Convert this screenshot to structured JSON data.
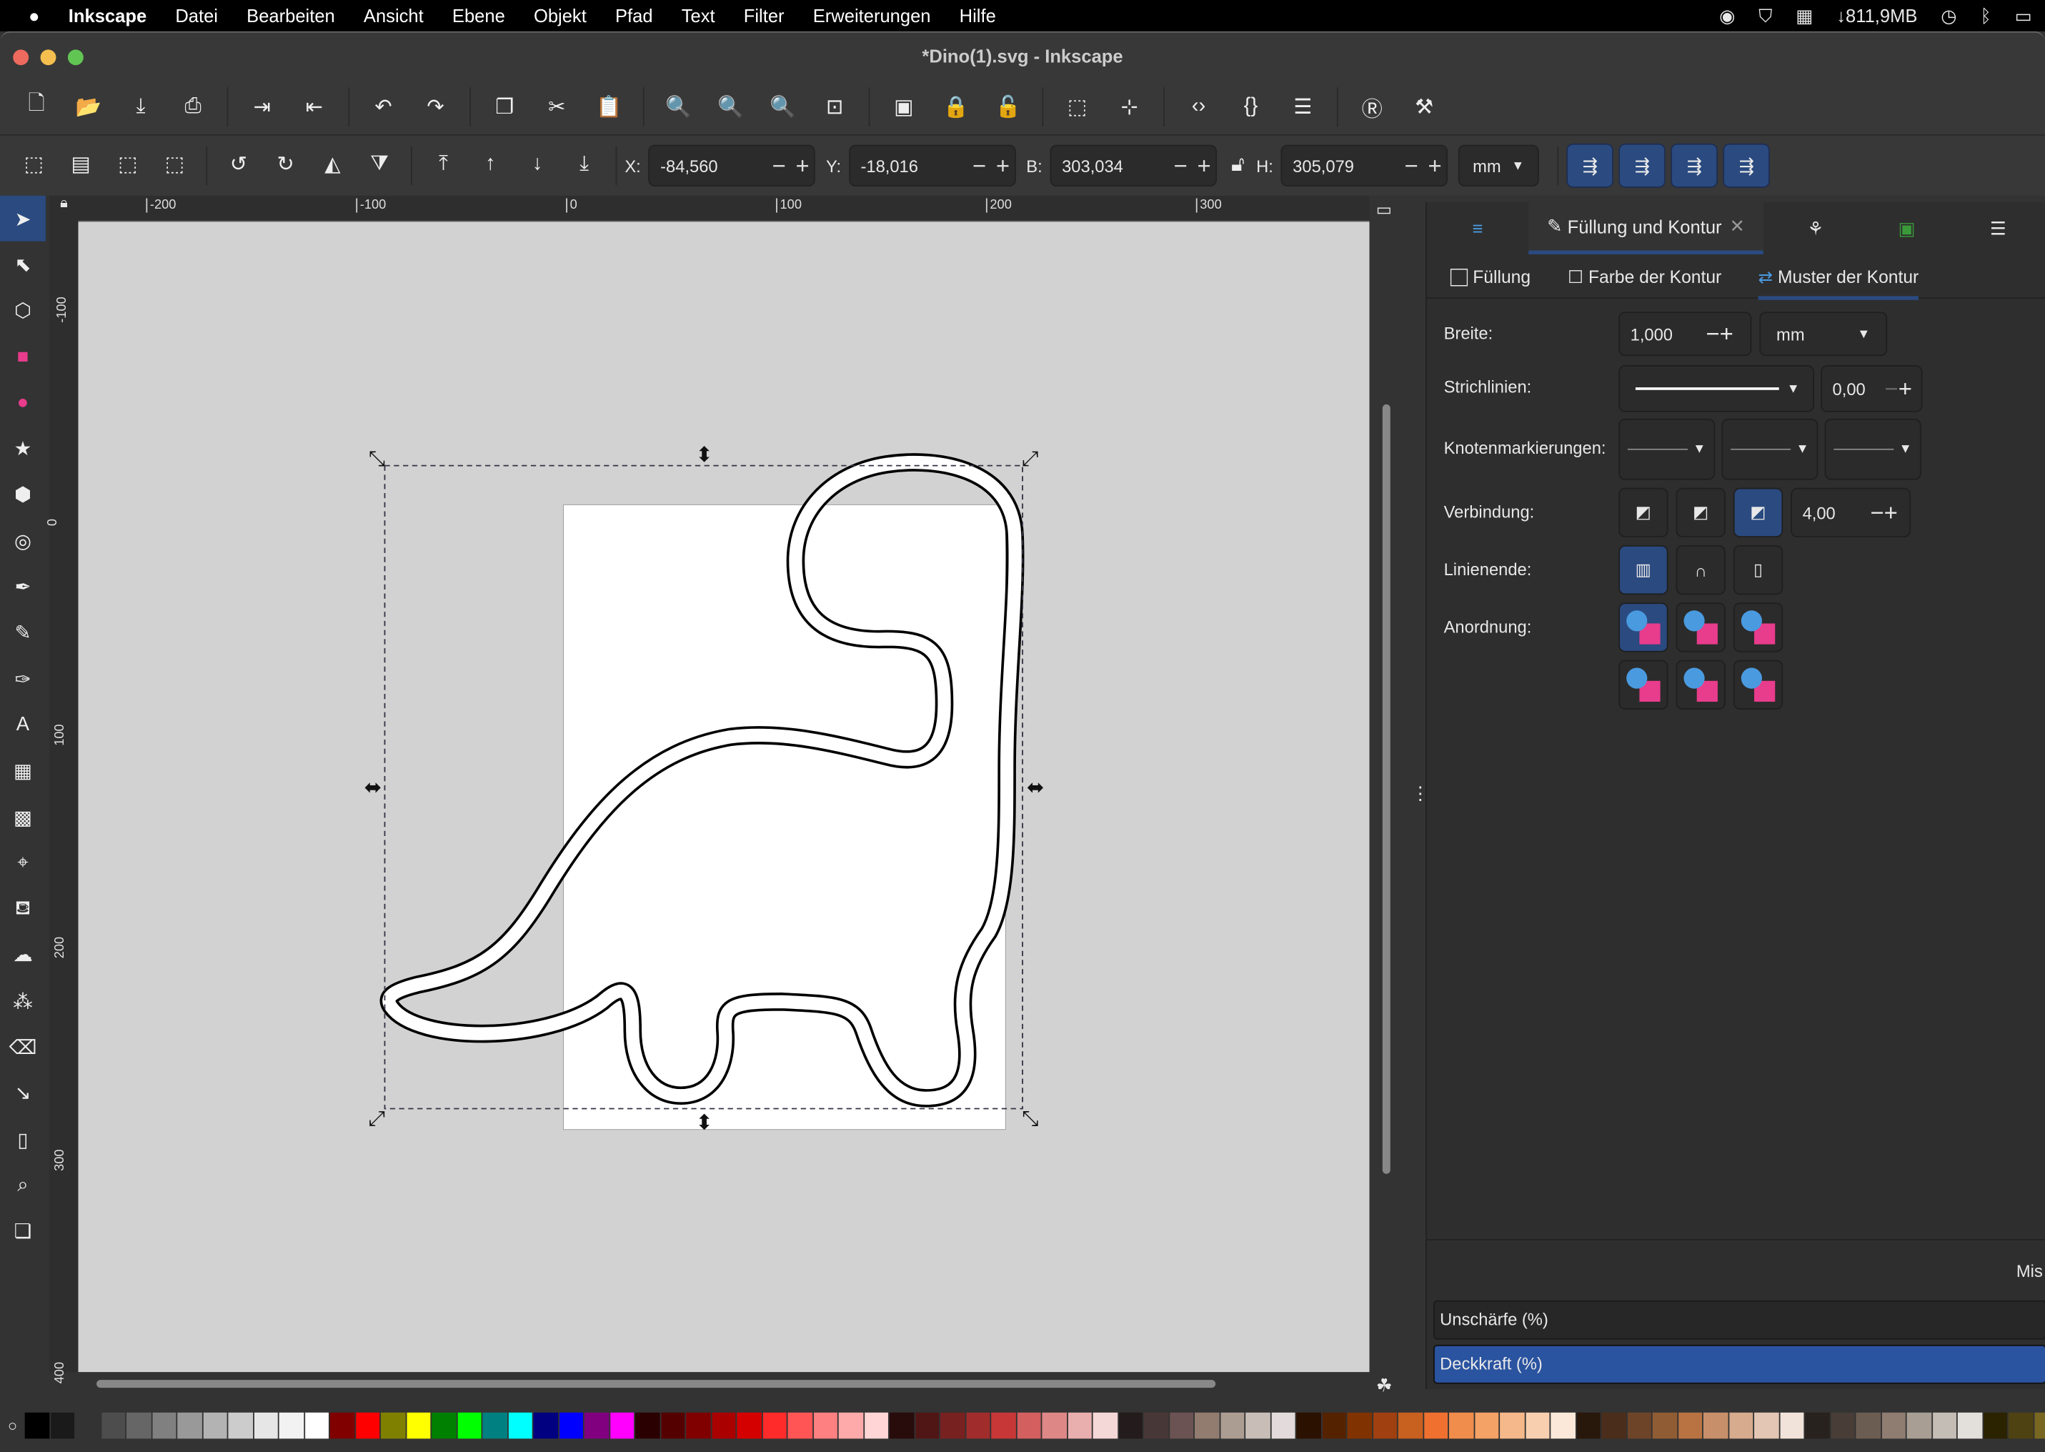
{
  "menubar": {
    "app": "Inkscape",
    "items": [
      "Datei",
      "Bearbeiten",
      "Ansicht",
      "Ebene",
      "Objekt",
      "Pfad",
      "Text",
      "Filter",
      "Erweiterungen",
      "Hilfe"
    ],
    "memory": "↓811,9MB"
  },
  "window": {
    "title": "*Dino(1).svg - Inkscape"
  },
  "toolbar1": [
    "new-document",
    "open",
    "import",
    "print",
    "import-file",
    "export",
    "undo",
    "redo",
    "duplicate",
    "cut",
    "paste",
    "zoom-selection",
    "zoom-drawing",
    "zoom-page",
    "zoom-center",
    "group",
    "lock",
    "unlock",
    "node-tool",
    "snap",
    "xml-editor",
    "css-editor",
    "align",
    "selectors",
    "preferences"
  ],
  "toolbar2": {
    "icons": [
      "select-all",
      "select-all-layers",
      "deselect",
      "touch-select",
      "rotate-ccw",
      "rotate-cw",
      "flip-horizontal",
      "flip-vertical",
      "raise-to-top",
      "raise",
      "lower",
      "lower-to-bottom"
    ],
    "x_label": "X:",
    "x": "-84,560",
    "y_label": "Y:",
    "y": "-18,016",
    "w_label": "B:",
    "w": "303,034",
    "h_label": "H:",
    "h": "305,079",
    "unit": "mm"
  },
  "tools": [
    "selector",
    "node",
    "shape-builder",
    "rectangle",
    "ellipse",
    "star",
    "3d-box",
    "spiral",
    "pen",
    "pencil",
    "calligraphy",
    "text",
    "gradient",
    "mesh",
    "dropper",
    "paint-bucket",
    "tweak",
    "spray",
    "eraser",
    "connector",
    "pages",
    "zoom",
    "measure"
  ],
  "ruler_top": [
    "-200",
    "-100",
    "0",
    "100",
    "200",
    "300"
  ],
  "ruler_left": [
    "-100",
    "0",
    "100",
    "200",
    "300",
    "400"
  ],
  "panel": {
    "tab_title": "Füllung und Kontur",
    "subtabs": [
      "Füllung",
      "Farbe der Kontur",
      "Muster der Kontur"
    ],
    "breite_label": "Breite:",
    "breite": "1,000",
    "breite_unit": "mm",
    "strich_label": "Strichlinien:",
    "strich_offset": "0,00",
    "knoten_label": "Knotenmarkierungen:",
    "verbindung_label": "Verbindung:",
    "miter": "4,00",
    "ende_label": "Linienende:",
    "anordnung_label": "Anordnung:",
    "mix_label": "Mis",
    "blur_label": "Unschärfe (%)",
    "opacity_label": "Deckkraft (%)"
  },
  "colors": {
    "accent": "#2a4a80",
    "canvas": "#d2d2d2"
  },
  "palette": [
    "#000000",
    "#1a1a1a",
    "#333333",
    "#4d4d4d",
    "#666666",
    "#808080",
    "#999999",
    "#b3b3b3",
    "#cccccc",
    "#e6e6e6",
    "#f2f2f2",
    "#ffffff",
    "#800000",
    "#ff0000",
    "#808000",
    "#ffff00",
    "#008000",
    "#00ff00",
    "#008080",
    "#00ffff",
    "#000080",
    "#0000ff",
    "#800080",
    "#ff00ff",
    "#2b0000",
    "#550000",
    "#800000",
    "#aa0000",
    "#d40000",
    "#ff2a2a",
    "#ff5555",
    "#ff8080",
    "#ffaaaa",
    "#ffd5d5",
    "#280b0b",
    "#501616",
    "#782121",
    "#a02c2c",
    "#c83737",
    "#d35f5f",
    "#de8787",
    "#e9afaf",
    "#f4d7d7",
    "#241c1c",
    "#483737",
    "#6c5353",
    "#917c6f",
    "#ac9d93",
    "#c8beb7",
    "#e3dbdb",
    "#2b1100",
    "#552200",
    "#803300",
    "#a04010",
    "#c86020",
    "#f07030",
    "#f08c4c",
    "#f4a266",
    "#f5b88a",
    "#f8d0b0",
    "#fbe8d8",
    "#28170b",
    "#4a2d1a",
    "#6e4428",
    "#905c34",
    "#b97343",
    "#c8906a",
    "#d6ab8e",
    "#e3c6b4",
    "#f1e3d9",
    "#28221e",
    "#483e37",
    "#6c5d53",
    "#8e7d70",
    "#a89e93",
    "#c4bdb5",
    "#e3dfdb",
    "#2b2200",
    "#4f4212",
    "#786721"
  ]
}
